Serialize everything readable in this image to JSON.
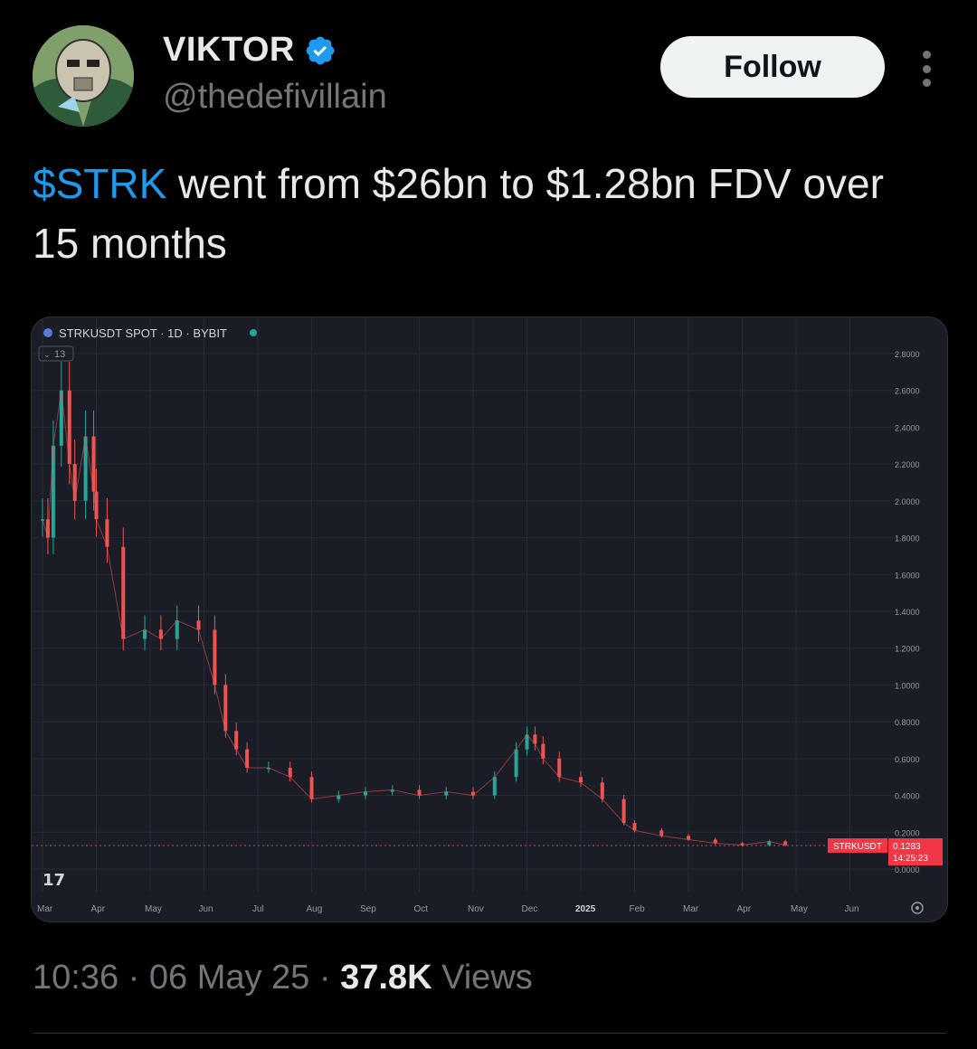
{
  "author": {
    "name": "VIKTOR",
    "handle": "@thedefivillain",
    "verified": true,
    "avatar_icon": "villain-mask-avatar"
  },
  "follow_label": "Follow",
  "tweet": {
    "cashtag": "$STRK",
    "text_rest": " went from $26bn to $1.28bn FDV over 15 months"
  },
  "chart_header": {
    "symbol": "STRKUSDT SPOT · 1D · BYBIT",
    "indicator": "13"
  },
  "chart_data": {
    "type": "line",
    "title": "STRKUSDT SPOT · 1D · BYBIT",
    "x_ticks": [
      "Mar",
      "Apr",
      "May",
      "Jun",
      "Jul",
      "Aug",
      "Sep",
      "Oct",
      "Nov",
      "Dec",
      "2025",
      "Feb",
      "Mar",
      "Apr",
      "May",
      "Jun"
    ],
    "y_ticks": [
      "2.8000",
      "2.6000",
      "2.4000",
      "2.2000",
      "2.0000",
      "1.8000",
      "1.6000",
      "1.4000",
      "1.2000",
      "1.0000",
      "0.8000",
      "0.6000",
      "0.4000",
      "0.2000",
      "0.0000"
    ],
    "ylim": [
      0,
      2.8
    ],
    "series": [
      {
        "x": [
          0,
          0.1,
          0.2,
          0.35,
          0.5,
          0.6,
          0.8,
          0.95,
          1.0,
          1.2,
          1.5,
          1.9,
          2.2,
          2.5,
          2.9,
          3.2,
          3.4,
          3.6,
          3.8,
          4.2,
          4.6,
          5.0,
          5.5,
          6.0,
          6.5,
          7.0,
          7.5,
          8.0,
          8.4,
          8.8,
          9.0,
          9.15,
          9.3,
          9.6,
          10.0,
          10.4,
          10.8,
          11.0,
          11.5,
          12.0,
          12.5,
          13.0,
          13.5,
          13.8
        ],
        "values": [
          1.9,
          1.8,
          2.3,
          2.6,
          2.2,
          2.0,
          2.35,
          2.05,
          1.9,
          1.75,
          1.25,
          1.3,
          1.25,
          1.35,
          1.3,
          1.0,
          0.75,
          0.65,
          0.55,
          0.55,
          0.5,
          0.38,
          0.4,
          0.42,
          0.43,
          0.4,
          0.42,
          0.4,
          0.5,
          0.65,
          0.73,
          0.68,
          0.6,
          0.5,
          0.47,
          0.38,
          0.25,
          0.21,
          0.18,
          0.16,
          0.14,
          0.13,
          0.15,
          0.13
        ]
      }
    ],
    "last_price_label": "STRKUSDT",
    "last_price": "0.1283",
    "countdown": "14:25:23",
    "colors": {
      "up": "#26a69a",
      "down": "#ef5350",
      "background": "#1b1d26",
      "axis_text": "#9598a1",
      "price_tag": "#f23645"
    }
  },
  "meta": {
    "time": "10:36",
    "sep": "·",
    "date": "06 May 25",
    "views_count": "37.8K",
    "views_label": "Views"
  }
}
